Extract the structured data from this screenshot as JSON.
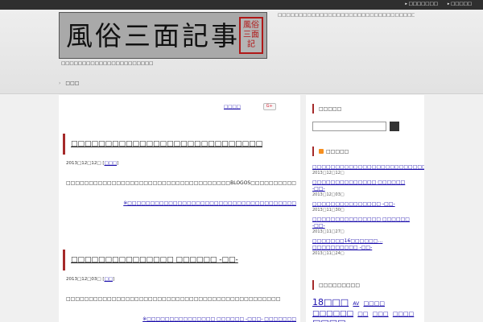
{
  "site": {
    "logo_text": "風俗三面記事",
    "seal_text": "風俗三面記",
    "description": "□□□□□□□□□□□□□□□□□□□□□□□□□□□□□□□□□□□□□□",
    "tagline": "□□□□□□□□□□□□□□□□□□□□□□",
    "top_links": [
      "□□□□□□□",
      "□□□□□"
    ],
    "nav_home": "□□□"
  },
  "share": {
    "label": "□□□□",
    "gplus": "G+"
  },
  "posts": [
    {
      "title": "□□□□□□□□□□□□□□□□□□□□□□□□□□□□",
      "date": "2013□12□12□",
      "category": "□□□",
      "body": "□□□□□□□□□□□□□□□□□□□□□□□□□□□□□□□□□□□□BLOGOS□□□□□□□□□□□□□□□□",
      "source": "※□□□□□□□□□□□□□□□□□□□□□□□□□□□□□□□□□□□□□"
    },
    {
      "title": "□□□□□□□□□□□□□□□ □□□□□□ -□□-",
      "date": "2013□12□03□",
      "category": "□□",
      "body": "□□□□□□□□□□□□□□□□□□□□□□□□□□□□□□□□□□□□□□□□□□□□□□□",
      "source": "※□□□□□□□□□□□□□□□ □□□□□□ -□□□- □□□□□□□"
    }
  ],
  "sidebar": {
    "search_title": "□□□□□",
    "search_value": "",
    "feed_title": "□□□□□",
    "feed_items": [
      {
        "label": "□□□□□□□□□□□□□□□□□□□□□□□□□□□□",
        "date": "2013□12□12□"
      },
      {
        "label": "□□□□□□□□□□□□□□ □□□□□□ -□□-",
        "date": "2013□12□03□"
      },
      {
        "label": "□□□□□□□□□□□□□□□ -□□-",
        "date": "2013□11□30□"
      },
      {
        "label": "□□□□□□□□□□□□□□□ □□□□□□ -□□-",
        "date": "2013□11□27□"
      },
      {
        "label": "□□□□□□□16□□□□□□…□□□□□□□□□□ -□□-",
        "date": "2013□11□24□"
      }
    ],
    "tags_title": "□□□□□□□□□",
    "tags": [
      {
        "label": "18□□□",
        "size": 11
      },
      {
        "label": "AV",
        "size": 6
      },
      {
        "label": "□□□□",
        "size": 7
      },
      {
        "label": "□□□□□□",
        "size": 9
      },
      {
        "label": "□□",
        "size": 7
      },
      {
        "label": "□□□",
        "size": 7
      },
      {
        "label": "□□□□",
        "size": 7
      },
      {
        "label": "□□□□",
        "size": 11
      },
      {
        "label": "□□□□□",
        "size": 6
      }
    ]
  }
}
